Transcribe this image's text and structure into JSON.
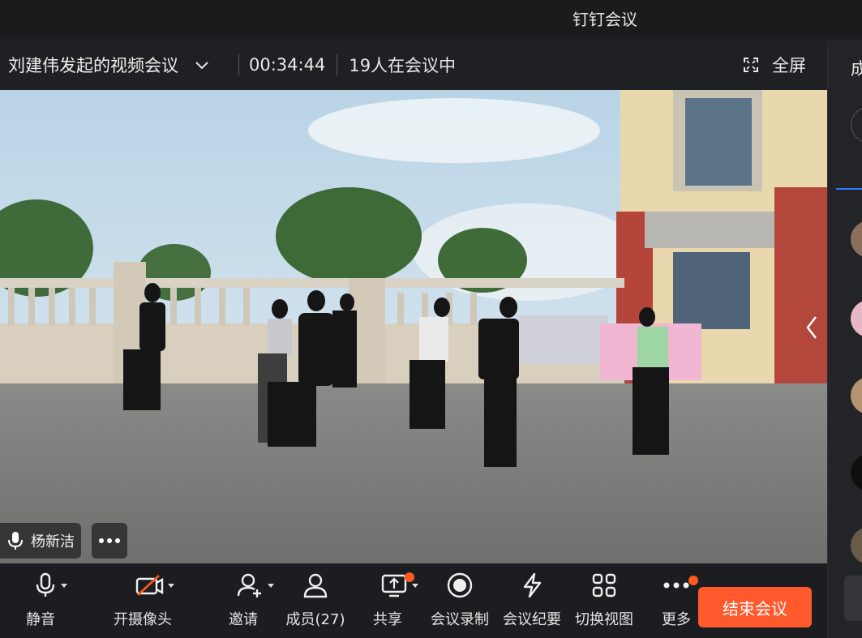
{
  "app_title": "钉钉会议",
  "meeting": {
    "title": "刘建伟发起的视频会议",
    "timer": "00:34:44",
    "participants": "19人在会议中",
    "fullscreen_label": "全屏"
  },
  "video": {
    "speaker_name": "杨新洁"
  },
  "toolbar": {
    "mute": "静音",
    "camera": "开摄像头",
    "invite": "邀请",
    "members": "成员(27)",
    "share": "共享",
    "record": "会议录制",
    "minutes": "会议纪要",
    "switch_view": "切换视图",
    "more": "更多",
    "end": "结束会议"
  },
  "right_panel": {
    "title": "成"
  },
  "colors": {
    "end_button": "#ff5a2e",
    "notification_dot": "#ff5a1f",
    "tab_accent": "#2b7cff"
  }
}
